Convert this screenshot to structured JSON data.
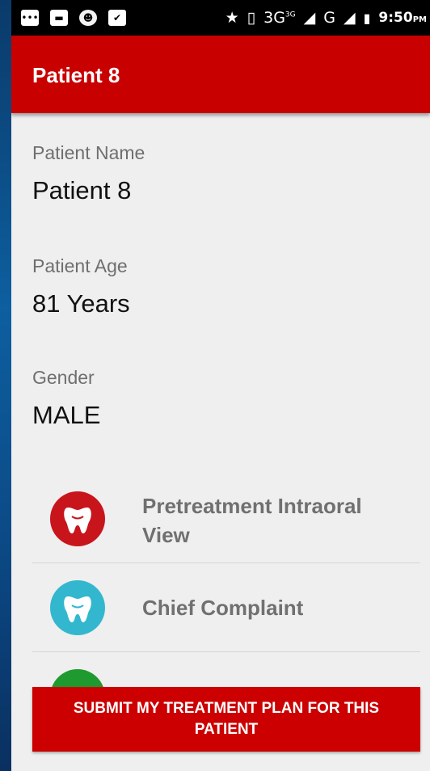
{
  "status_bar": {
    "network": "3G",
    "network_superscript": "3G",
    "network2": "G",
    "time": "9:50",
    "ampm": "PM"
  },
  "app_bar": {
    "title": "Patient 8"
  },
  "fields": [
    {
      "label": "Patient Name",
      "value": "Patient 8"
    },
    {
      "label": "Patient Age",
      "value": "81 Years"
    },
    {
      "label": "Gender",
      "value": "MALE"
    }
  ],
  "sections": [
    {
      "label": "Pretreatment Intraoral View",
      "icon": "tooth-icon",
      "color": "#c8151b"
    },
    {
      "label": "Chief Complaint",
      "icon": "tooth-icon",
      "color": "#33b7cf"
    },
    {
      "label": "",
      "icon": "tooth-icon",
      "color": "#1f9a2e"
    }
  ],
  "submit_button": {
    "label": "SUBMIT MY TREATMENT PLAN FOR THIS PATIENT"
  }
}
